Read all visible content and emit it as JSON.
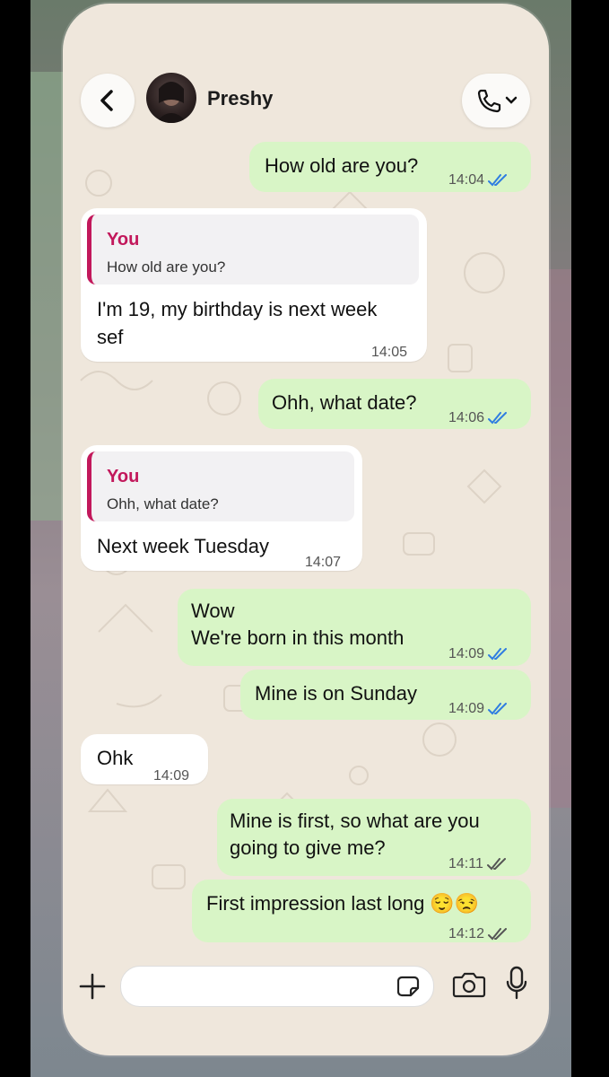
{
  "header": {
    "contact_name": "Preshy",
    "back_icon": "chevron-left-icon",
    "call_icon": "phone-icon"
  },
  "messages": [
    {
      "direction": "out",
      "text": "How old are you?",
      "time": "14:04",
      "status": "read"
    },
    {
      "direction": "in",
      "reply_author": "You",
      "reply_text": "How old are you?",
      "text_line1": "I'm 19, my birthday is next week",
      "text_line2": "sef",
      "time": "14:05"
    },
    {
      "direction": "out",
      "text": "Ohh, what date?",
      "time": "14:06",
      "status": "read"
    },
    {
      "direction": "in",
      "reply_author": "You",
      "reply_text": "Ohh, what date?",
      "text": "Next week Tuesday",
      "time": "14:07"
    },
    {
      "direction": "out",
      "text_line1": "Wow",
      "text_line2": "We're born in this month",
      "time": "14:09",
      "status": "read"
    },
    {
      "direction": "out",
      "text": "Mine is on Sunday",
      "time": "14:09",
      "status": "read"
    },
    {
      "direction": "in",
      "text": "Ohk",
      "time": "14:09"
    },
    {
      "direction": "out",
      "text_line1": "Mine is first, so what are you",
      "text_line2": "going to give me?",
      "time": "14:11",
      "status": "delivered"
    },
    {
      "direction": "out",
      "text": "First impression last long 😌😒",
      "time": "14:12",
      "status": "delivered"
    }
  ],
  "composer": {
    "input_value": "",
    "plus_icon": "plus-icon",
    "sticker_icon": "sticker-icon",
    "camera_icon": "camera-icon",
    "mic_icon": "microphone-icon"
  },
  "colors": {
    "outgoing_bubble": "#d8f5c6",
    "incoming_bubble": "#ffffff",
    "read_ticks": "#2f7de1",
    "delivered_ticks": "#555555",
    "reply_accent": "#c2185b",
    "chat_background": "#efe7dc"
  }
}
